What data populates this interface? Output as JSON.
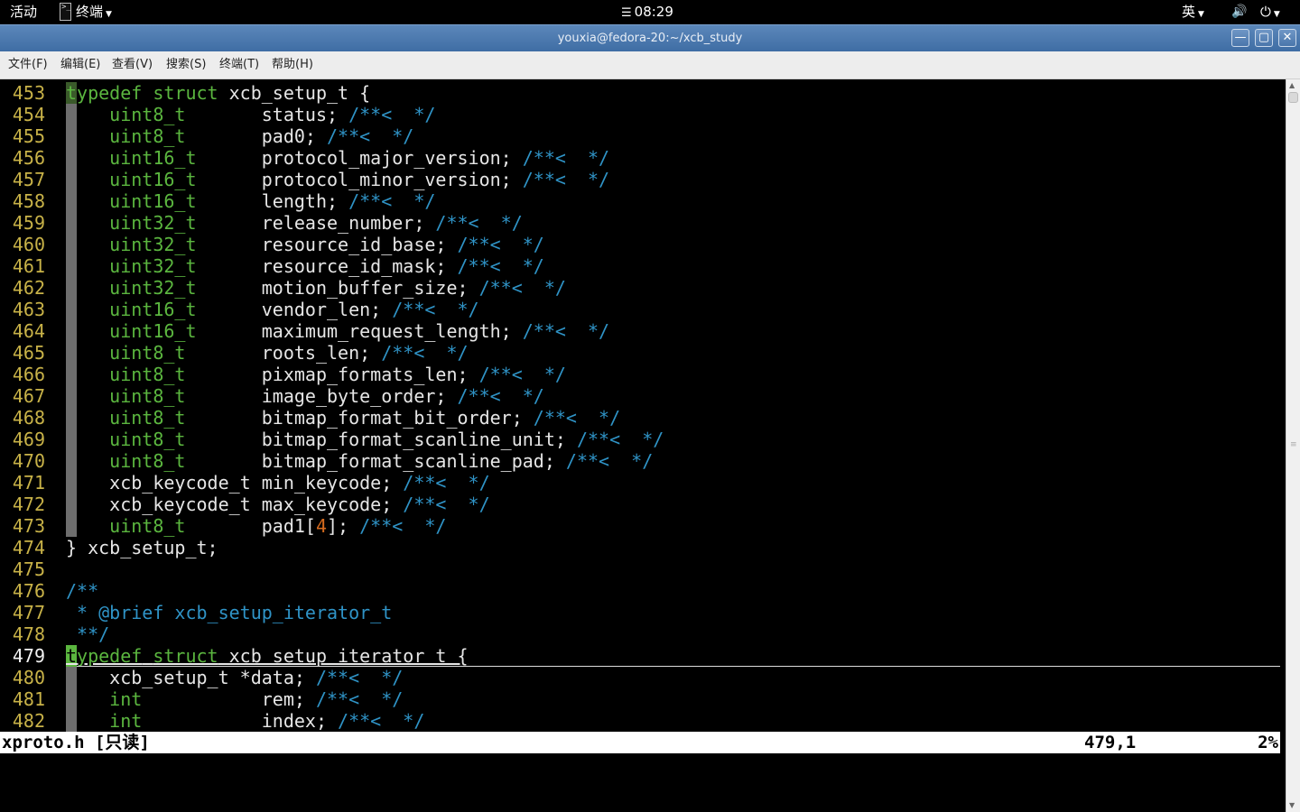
{
  "topbar": {
    "activities": "活动",
    "app_menu": "终端",
    "clock": "08:29",
    "input_method": "英"
  },
  "window": {
    "title": "youxia@fedora-20:~/xcb_study",
    "minimize": "—",
    "maximize": "▢",
    "close": "✕"
  },
  "menu": {
    "items": [
      "文件(F)",
      "编辑(E)",
      "查看(V)",
      "搜索(S)",
      "终端(T)",
      "帮助(H)"
    ]
  },
  "editor": {
    "lines": [
      {
        "n": "453",
        "code": "typedef struct xcb_setup_t {"
      },
      {
        "n": "454",
        "code": "    uint8_t       status; /**<  */"
      },
      {
        "n": "455",
        "code": "    uint8_t       pad0; /**<  */"
      },
      {
        "n": "456",
        "code": "    uint16_t      protocol_major_version; /**<  */"
      },
      {
        "n": "457",
        "code": "    uint16_t      protocol_minor_version; /**<  */"
      },
      {
        "n": "458",
        "code": "    uint16_t      length; /**<  */"
      },
      {
        "n": "459",
        "code": "    uint32_t      release_number; /**<  */"
      },
      {
        "n": "460",
        "code": "    uint32_t      resource_id_base; /**<  */"
      },
      {
        "n": "461",
        "code": "    uint32_t      resource_id_mask; /**<  */"
      },
      {
        "n": "462",
        "code": "    uint32_t      motion_buffer_size; /**<  */"
      },
      {
        "n": "463",
        "code": "    uint16_t      vendor_len; /**<  */"
      },
      {
        "n": "464",
        "code": "    uint16_t      maximum_request_length; /**<  */"
      },
      {
        "n": "465",
        "code": "    uint8_t       roots_len; /**<  */"
      },
      {
        "n": "466",
        "code": "    uint8_t       pixmap_formats_len; /**<  */"
      },
      {
        "n": "467",
        "code": "    uint8_t       image_byte_order; /**<  */"
      },
      {
        "n": "468",
        "code": "    uint8_t       bitmap_format_bit_order; /**<  */"
      },
      {
        "n": "469",
        "code": "    uint8_t       bitmap_format_scanline_unit; /**<  */"
      },
      {
        "n": "470",
        "code": "    uint8_t       bitmap_format_scanline_pad; /**<  */"
      },
      {
        "n": "471",
        "code": "    xcb_keycode_t min_keycode; /**<  */"
      },
      {
        "n": "472",
        "code": "    xcb_keycode_t max_keycode; /**<  */"
      },
      {
        "n": "473",
        "code": "    uint8_t       pad1[4]; /**<  */"
      },
      {
        "n": "474",
        "code": "} xcb_setup_t;"
      },
      {
        "n": "475",
        "code": ""
      },
      {
        "n": "476",
        "code": "/**"
      },
      {
        "n": "477",
        "code": " * @brief xcb_setup_iterator_t"
      },
      {
        "n": "478",
        "code": " **/"
      },
      {
        "n": "479",
        "code": "typedef struct xcb_setup_iterator_t {"
      },
      {
        "n": "480",
        "code": "    xcb_setup_t *data; /**<  */"
      },
      {
        "n": "481",
        "code": "    int           rem; /**<  */"
      },
      {
        "n": "482",
        "code": "    int           index; /**<  */"
      }
    ],
    "cursor_line": "479",
    "status": {
      "file": "xproto.h [只读]",
      "position": "479,1",
      "percent": "2%"
    }
  },
  "colors": {
    "keyword": "#5bb63f",
    "comment": "#2f93c6",
    "line_number": "#c8b248",
    "number": "#d46a1e",
    "titlebar": "#4a78ae"
  },
  "icons": [
    "terminal-icon",
    "calendar-icon",
    "volume-icon",
    "power-icon"
  ]
}
